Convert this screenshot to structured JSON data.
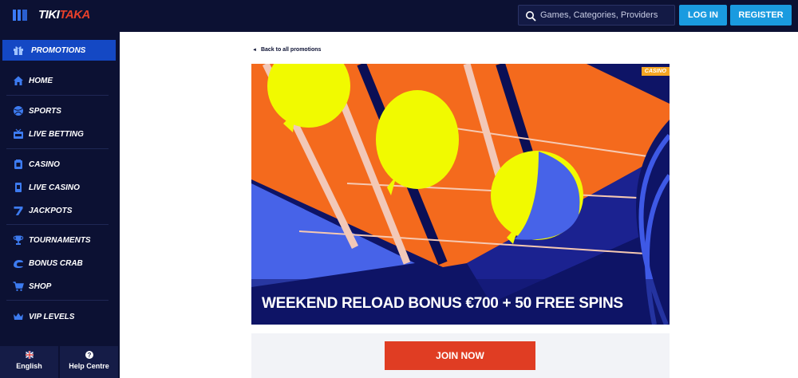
{
  "header": {
    "logo_part1": "TIKI",
    "logo_part2": "TAKA",
    "search_placeholder": "Games, Categories, Providers",
    "login_label": "LOG IN",
    "register_label": "REGISTER"
  },
  "sidebar": {
    "items": [
      {
        "label": "PROMOTIONS",
        "icon": "gift-icon"
      },
      {
        "label": "HOME",
        "icon": "home-icon"
      },
      {
        "label": "SPORTS",
        "icon": "ball-icon"
      },
      {
        "label": "LIVE BETTING",
        "icon": "live-tv-icon"
      },
      {
        "label": "CASINO",
        "icon": "casino-chip-icon"
      },
      {
        "label": "LIVE CASINO",
        "icon": "card-icon"
      },
      {
        "label": "JACKPOTS",
        "icon": "seven-icon"
      },
      {
        "label": "TOURNAMENTS",
        "icon": "trophy-icon"
      },
      {
        "label": "BONUS CRAB",
        "icon": "crab-icon"
      },
      {
        "label": "SHOP",
        "icon": "cart-icon"
      },
      {
        "label": "VIP LEVELS",
        "icon": "crown-icon"
      }
    ],
    "active_index": 0,
    "language_label": "English",
    "help_label": "Help Centre"
  },
  "main": {
    "back_link": "Back to all promotions",
    "banner_tag": "CASINO",
    "banner_title": "WEEKEND RELOAD BONUS €700 + 50 FREE SPINS",
    "join_label": "JOIN NOW"
  },
  "colors": {
    "topbar": "#0c1133",
    "accent_blue": "#1a9be0",
    "active_nav": "#1448c4",
    "join_button": "#e03d23",
    "tag": "#f5a623"
  }
}
